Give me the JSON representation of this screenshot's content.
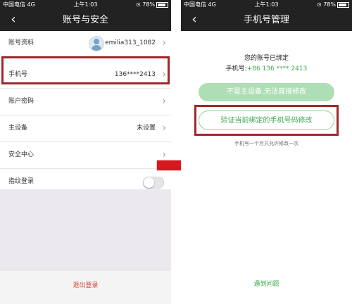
{
  "status": {
    "carrier": "中国电信",
    "network": "4G",
    "time": "上午1:03",
    "battery": "78%"
  },
  "left": {
    "title": "账号与安全",
    "rows": [
      {
        "label": "账号资料",
        "value": "emilia313_1082"
      },
      {
        "label": "手机号",
        "value": "136****2413"
      },
      {
        "label": "账户密码",
        "value": ""
      },
      {
        "label": "主设备",
        "value": "未设置"
      },
      {
        "label": "安全中心",
        "value": ""
      },
      {
        "label": "指纹登录",
        "value": ""
      }
    ],
    "logout": "退出登录"
  },
  "right": {
    "title": "手机号管理",
    "bound_title": "您的账号已绑定",
    "phone_prefix": "手机号:",
    "phone_number": "+86 136 **** 2413",
    "disabled_button": "不是主设备,无法直接修改",
    "verify_button": "验证当前绑定的手机号码修改",
    "note": "手机号一个月只允许修改一次",
    "problem_link": "遇到问题"
  },
  "colors": {
    "accent_green": "#3eaa50",
    "highlight_red": "#a2262b",
    "arrow_red": "#d7191f",
    "logout_red": "#d9433b"
  }
}
